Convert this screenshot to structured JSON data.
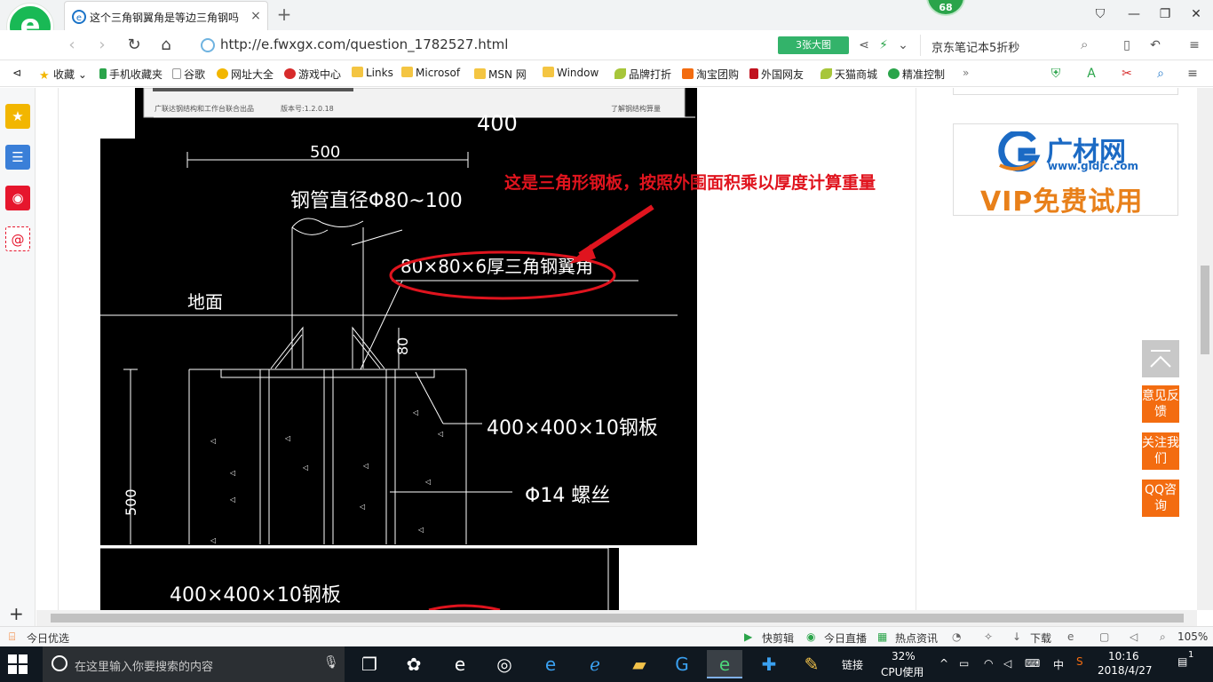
{
  "tab": {
    "title": "这个三角钢翼角是等边三角钢吗",
    "close": "×",
    "new_tab": "+"
  },
  "badge": {
    "count": "68"
  },
  "window_controls": {
    "pin": "⛉",
    "min": "—",
    "max": "❐",
    "close": "✕"
  },
  "address": {
    "url": "http://e.fwxgx.com/question_1782527.html",
    "big_image_label": "3张大图",
    "search_text": "京东笔记本5折秒"
  },
  "bookmarks": {
    "items": [
      {
        "label": "收藏",
        "icon": "star-icon"
      },
      {
        "label": "手机收藏夹",
        "icon": "phone-icon"
      },
      {
        "label": "谷歌",
        "icon": "page-icon"
      },
      {
        "label": "网址大全",
        "icon": "globe-icon"
      },
      {
        "label": "游戏中心",
        "icon": "game-icon"
      },
      {
        "label": "Links",
        "icon": "folder-icon"
      },
      {
        "label": "Microsof",
        "icon": "folder-icon"
      },
      {
        "label": "MSN 网",
        "icon": "folder-icon"
      },
      {
        "label": "Window",
        "icon": "folder-icon"
      },
      {
        "label": "品牌打折",
        "icon": "leaf-icon"
      },
      {
        "label": "淘宝团购",
        "icon": "taobao-icon"
      },
      {
        "label": "外国网友",
        "icon": "flag-icon"
      },
      {
        "label": "天猫商城",
        "icon": "leaf-icon"
      },
      {
        "label": "精准控制",
        "icon": "wechat-icon"
      }
    ],
    "more": "»"
  },
  "cad": {
    "toolbar_left": "广联达钢结构和工作台联合出品",
    "toolbar_version": "版本号:1.2.0.18",
    "toolbar_right": "了解钢结构算量",
    "dim_top": "400",
    "dim_500": "500",
    "pipe_label": "钢管直径Φ80~100",
    "angle_label": "80×80×6厚三角钢翼角",
    "ground_label": "地面",
    "dim_80": "80",
    "plate_label": "400×400×10钢板",
    "bolt_label": "Φ14 螺丝",
    "dim_500_vert": "500",
    "plate_label_bottom": "400×400×10钢板"
  },
  "annotation": {
    "caption": "这是三角形钢板，按照外围面积乘以厚度计算重量"
  },
  "ad": {
    "brand": "广材网",
    "site": "www.gldjc.com",
    "vip": "VIP免费试用"
  },
  "float_buttons": {
    "feedback": "意见反馈",
    "follow": "关注我们",
    "qq": "QQ咨询"
  },
  "status": {
    "left": "今日优选",
    "kuaijianji": "快剪辑",
    "live": "今日直播",
    "news": "热点资讯",
    "download": "下载",
    "zoom": "105%"
  },
  "taskbar": {
    "search_placeholder": "在这里输入你要搜索的内容",
    "links": "链接",
    "cpu_percent": "32%",
    "cpu_label": "CPU使用",
    "ime": "中",
    "time": "10:16",
    "date": "2018/4/27",
    "notif_count": "1"
  },
  "colors": {
    "accent_green": "#19b955",
    "annotation_red": "#e0141e",
    "float_orange": "#f36c10",
    "ad_blue": "#1b6ac4"
  }
}
